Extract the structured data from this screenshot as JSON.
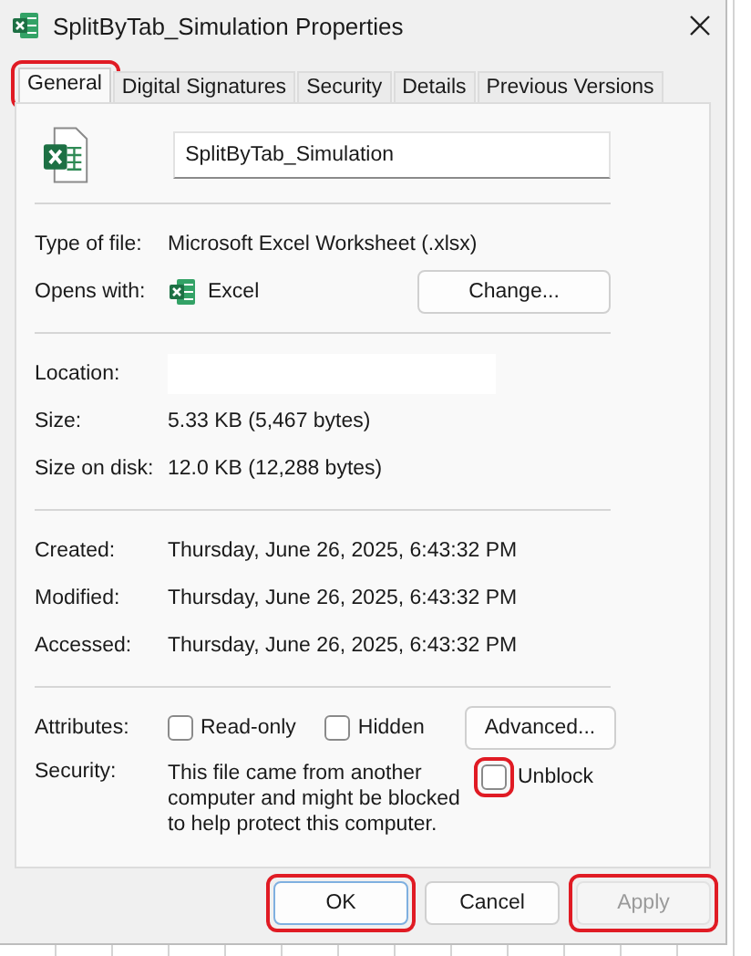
{
  "window": {
    "title": "SplitByTab_Simulation Properties"
  },
  "tabs": [
    {
      "label": "General",
      "selected": true,
      "highlighted": true
    },
    {
      "label": "Digital Signatures",
      "selected": false,
      "highlighted": false
    },
    {
      "label": "Security",
      "selected": false,
      "highlighted": false
    },
    {
      "label": "Details",
      "selected": false,
      "highlighted": false
    },
    {
      "label": "Previous Versions",
      "selected": false,
      "highlighted": false
    }
  ],
  "file_name": {
    "value": "SplitByTab_Simulation"
  },
  "sections": [
    [
      {
        "kind": "text",
        "label": "Type of file:",
        "value": "Microsoft Excel Worksheet (.xlsx)"
      },
      {
        "kind": "app",
        "label": "Opens with:",
        "value": "Excel",
        "button": "Change..."
      }
    ],
    [
      {
        "kind": "redacted",
        "label": "Location:"
      },
      {
        "kind": "text",
        "label": "Size:",
        "value": "5.33 KB (5,467 bytes)"
      },
      {
        "kind": "text",
        "label": "Size on disk:",
        "value": "12.0 KB (12,288 bytes)"
      }
    ],
    [
      {
        "kind": "text",
        "label": "Created:",
        "value": "Thursday, June 26, 2025, 6:43:32 PM"
      },
      {
        "kind": "text",
        "label": "Modified:",
        "value": "Thursday, June 26, 2025, 6:43:32 PM"
      },
      {
        "kind": "text",
        "label": "Accessed:",
        "value": "Thursday, June 26, 2025, 6:43:32 PM"
      }
    ]
  ],
  "attributes": {
    "label": "Attributes:",
    "options": [
      {
        "label": "Read-only",
        "checked": false
      },
      {
        "label": "Hidden",
        "checked": false
      }
    ],
    "button": "Advanced..."
  },
  "security": {
    "label": "Security:",
    "text": "This file came from another computer and might be blocked to help protect this computer.",
    "unblock": {
      "label": "Unblock",
      "checked": false,
      "highlighted": true
    }
  },
  "buttons": [
    {
      "label": "OK",
      "default": true,
      "disabled": false,
      "highlighted": true
    },
    {
      "label": "Cancel",
      "default": false,
      "disabled": false,
      "highlighted": false
    },
    {
      "label": "Apply",
      "default": false,
      "disabled": true,
      "highlighted": true
    }
  ]
}
